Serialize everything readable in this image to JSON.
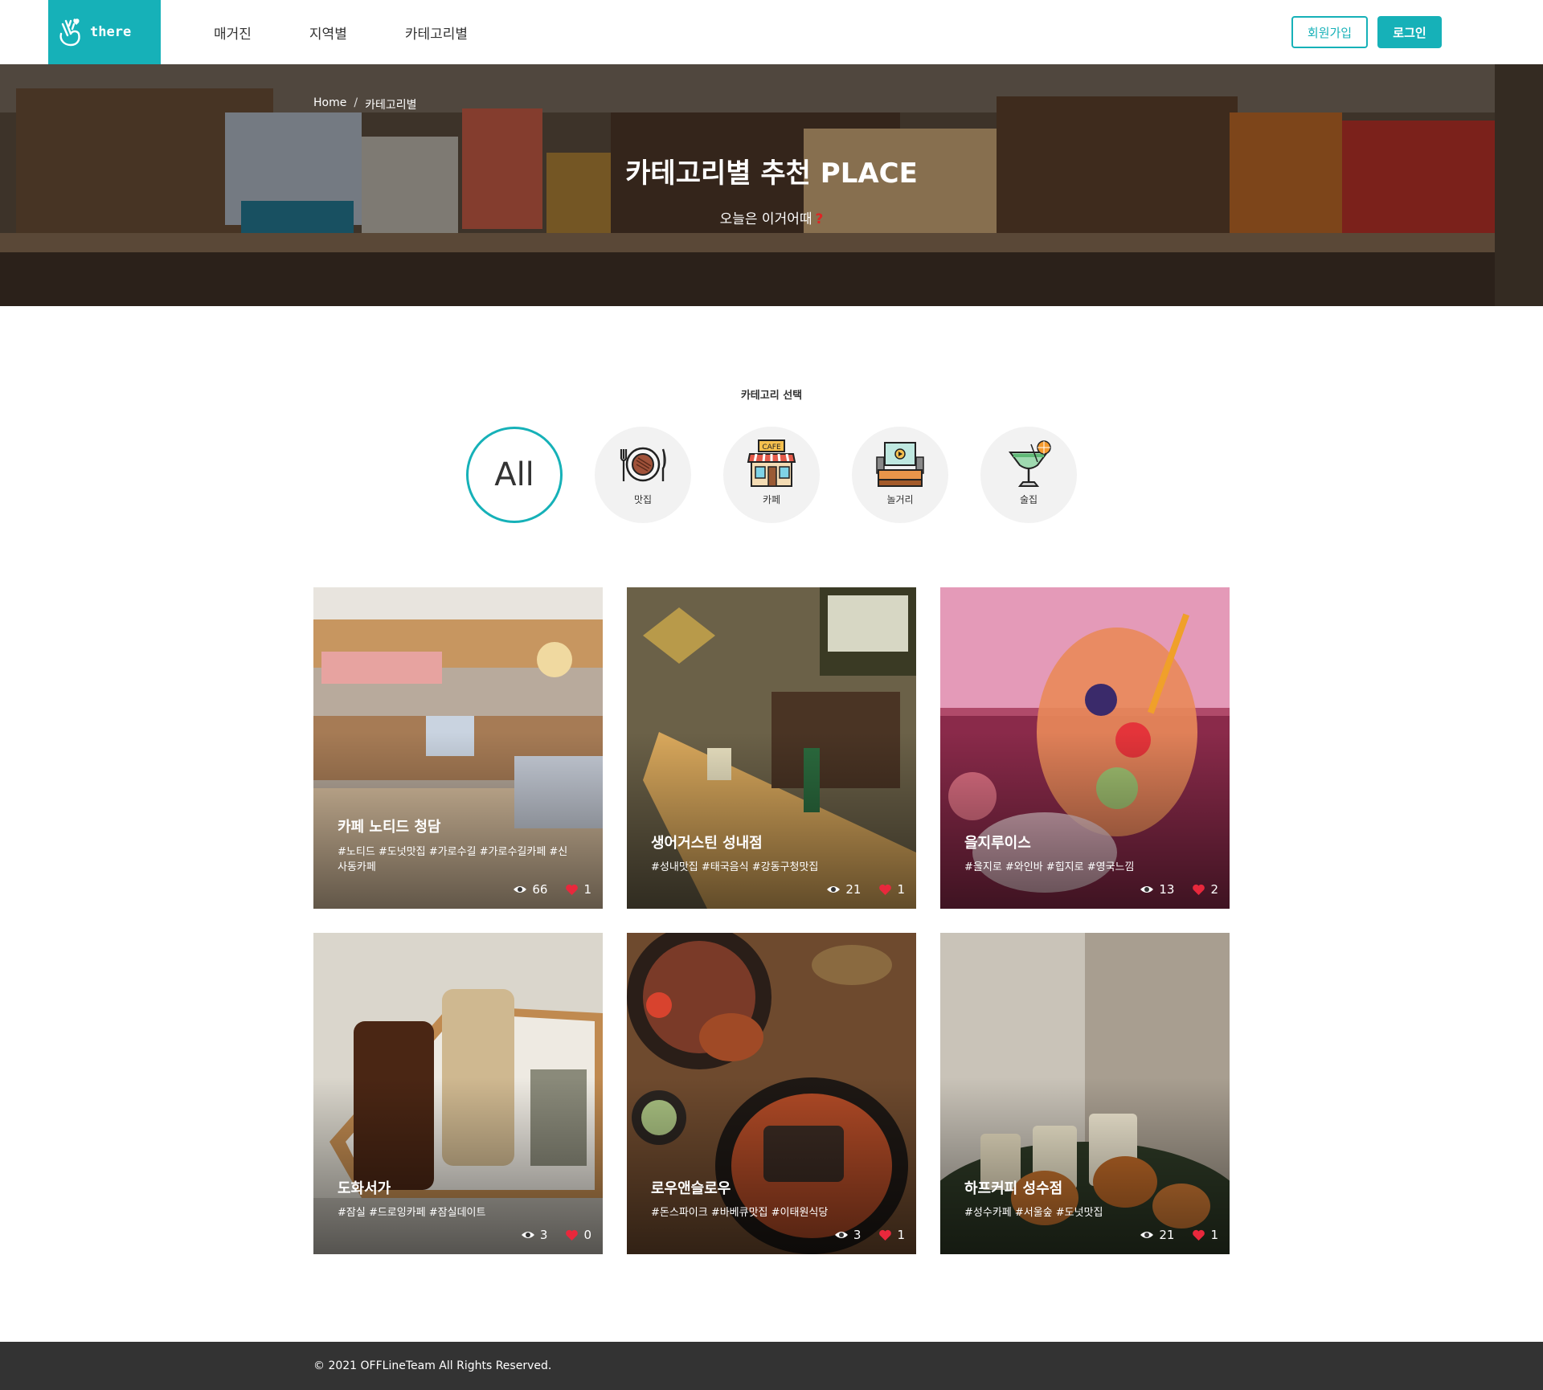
{
  "header": {
    "logo_text": "there",
    "nav": [
      "매거진",
      "지역별",
      "카테고리별"
    ],
    "signup_label": "회원가입",
    "login_label": "로그인"
  },
  "hero": {
    "breadcrumb": [
      "Home",
      "카테고리별"
    ],
    "breadcrumb_separator": "/",
    "title": "카테고리별 추천 PLACE",
    "subtitle": "오늘은 이거어때",
    "subtitle_emoji": "?"
  },
  "categories": {
    "label": "카테고리 선택",
    "items": [
      {
        "name": "All",
        "icon": "all-text",
        "active": true
      },
      {
        "name": "맛집",
        "icon": "plate-icon",
        "active": false
      },
      {
        "name": "카페",
        "icon": "cafe-storefront-icon",
        "active": false
      },
      {
        "name": "놀거리",
        "icon": "stage-screen-icon",
        "active": false
      },
      {
        "name": "술집",
        "icon": "cocktail-icon",
        "active": false
      }
    ]
  },
  "cards": [
    {
      "title": "카페 노티드 청담",
      "tags": "#노티드 #도넛맛집 #가로수길 #가로수길카페 #신사동카페",
      "views": "66",
      "likes": "1"
    },
    {
      "title": "생어거스틴 성내점",
      "tags": "#성내맛집 #태국음식 #강동구청맛집",
      "views": "21",
      "likes": "1"
    },
    {
      "title": "을지루이스",
      "tags": "#을지로 #와인바 #힙지로 #영국느낌",
      "views": "13",
      "likes": "2"
    },
    {
      "title": "도화서가",
      "tags": "#잠실 #드로잉카페 #잠실데이트",
      "views": "3",
      "likes": "0"
    },
    {
      "title": "로우앤슬로우",
      "tags": "#돈스파이크 #바베큐맛집 #이태원식당",
      "views": "3",
      "likes": "1"
    },
    {
      "title": "하프커피 성수점",
      "tags": "#성수카페 #서울숲 #도넛맛집",
      "views": "21",
      "likes": "1"
    }
  ],
  "colors": {
    "accent": "#16b1b8",
    "selected_card_border": "#16a3aa",
    "like_heart": "#e8283c",
    "footer_bg": "#333333"
  },
  "footer": {
    "copyright": "© 2021 OFFLineTeam All Rights Reserved."
  }
}
